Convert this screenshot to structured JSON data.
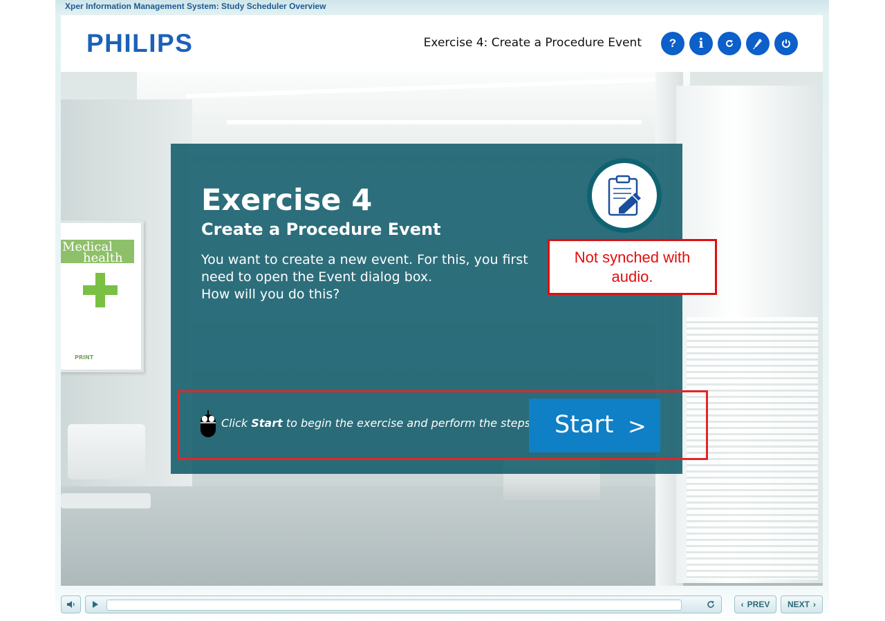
{
  "app": {
    "title": "Xper Information Management System: Study Scheduler Overview"
  },
  "header": {
    "logo_text": "PHILIPS",
    "exercise_title": "Exercise 4: Create a Procedure Event",
    "buttons": [
      {
        "label": "?",
        "icon": "help-icon"
      },
      {
        "label": "i",
        "icon": "info-icon"
      },
      {
        "label": "",
        "icon": "replay-icon"
      },
      {
        "label": "",
        "icon": "glossary-pen-icon"
      },
      {
        "label": "",
        "icon": "power-icon"
      }
    ]
  },
  "poster": {
    "line1": "Medical",
    "line2": "health",
    "print": "PRINT"
  },
  "content": {
    "heading": "Exercise 4",
    "subheading": "Create a Procedure Event",
    "body_lines": [
      "You want to create a new event. For this, you first",
      "need to open the Event dialog box.",
      "How will you do this?"
    ],
    "icon": "clipboard-pencil-icon",
    "instruction_prefix": "Click ",
    "instruction_bold": "Start",
    "instruction_suffix": " to begin the exercise and perform the steps.",
    "start_label": "Start",
    "start_arrow": ">"
  },
  "annotation": {
    "note_line1": "Not synched with",
    "note_line2": "audio."
  },
  "controls": {
    "mute_icon": "speaker-icon",
    "play_icon": "play-icon",
    "refresh_icon": "refresh-icon",
    "progress": 0.0,
    "prev_label": "PREV",
    "next_label": "NEXT"
  },
  "colors": {
    "philips_blue": "#1b61b8",
    "panel_teal": "#0d5968",
    "start_blue": "#0f7fc6",
    "annotation_red": "#e10d0d"
  }
}
